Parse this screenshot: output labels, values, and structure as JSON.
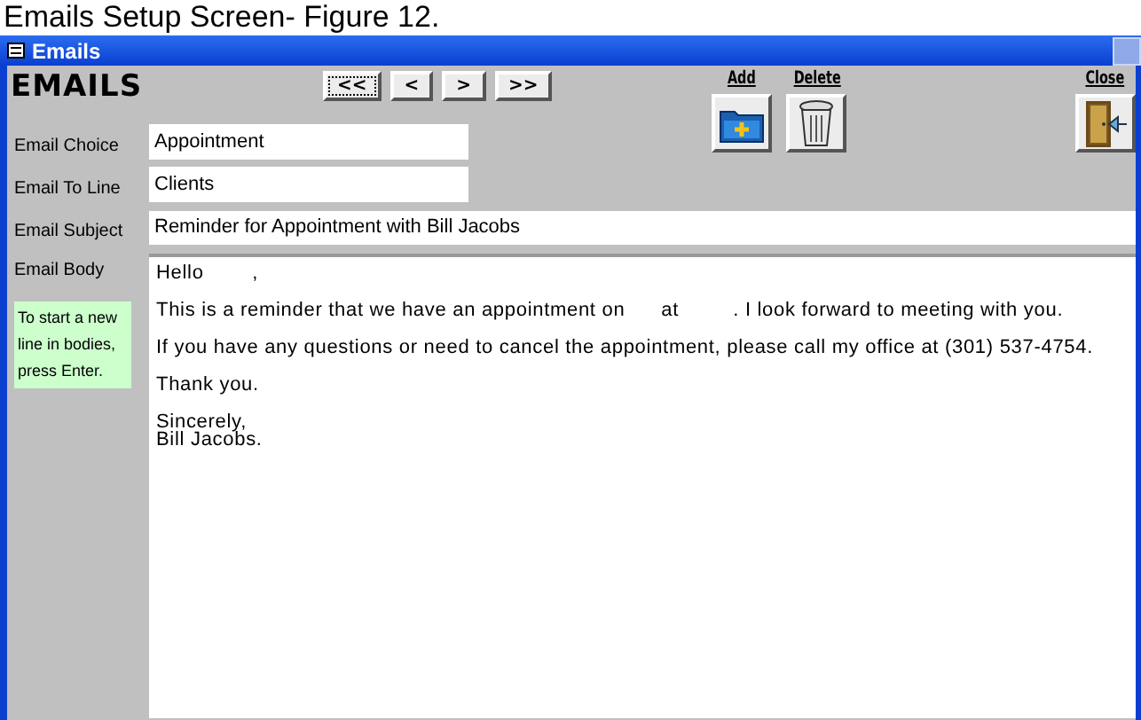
{
  "caption": "Emails Setup Screen- Figure 12.",
  "window": {
    "title": "Emails"
  },
  "form_title": "EMAILS",
  "nav_buttons": [
    {
      "label": "<<",
      "focused": true
    },
    {
      "label": "<",
      "focused": false
    },
    {
      "label": ">",
      "focused": false
    },
    {
      "label": ">>",
      "focused": false
    }
  ],
  "actions": [
    {
      "kind": "add",
      "label": "Add"
    },
    {
      "kind": "delete",
      "label": "Delete"
    },
    {
      "kind": "close",
      "label": "Close"
    }
  ],
  "fields": [
    {
      "label": "Email Choice",
      "value": "Appointment",
      "kind": "short"
    },
    {
      "label": "Email To Line",
      "value": "Clients",
      "kind": "short"
    },
    {
      "label": "Email Subject",
      "value": "Reminder for Appointment with Bill Jacobs",
      "kind": "wide"
    },
    {
      "label": "Email Body",
      "value": "Hello        ,\n\nThis is a reminder that we have an appointment on      at         . I look forward to meeting with you.\n\nIf you have any questions or need to cancel the appointment, please call my office at (301) 537-4754.\n\nThank you.\n\nSincerely,\nBill Jacobs.",
      "kind": "body"
    }
  ],
  "hint": "To start a new line in bodies, press Enter."
}
